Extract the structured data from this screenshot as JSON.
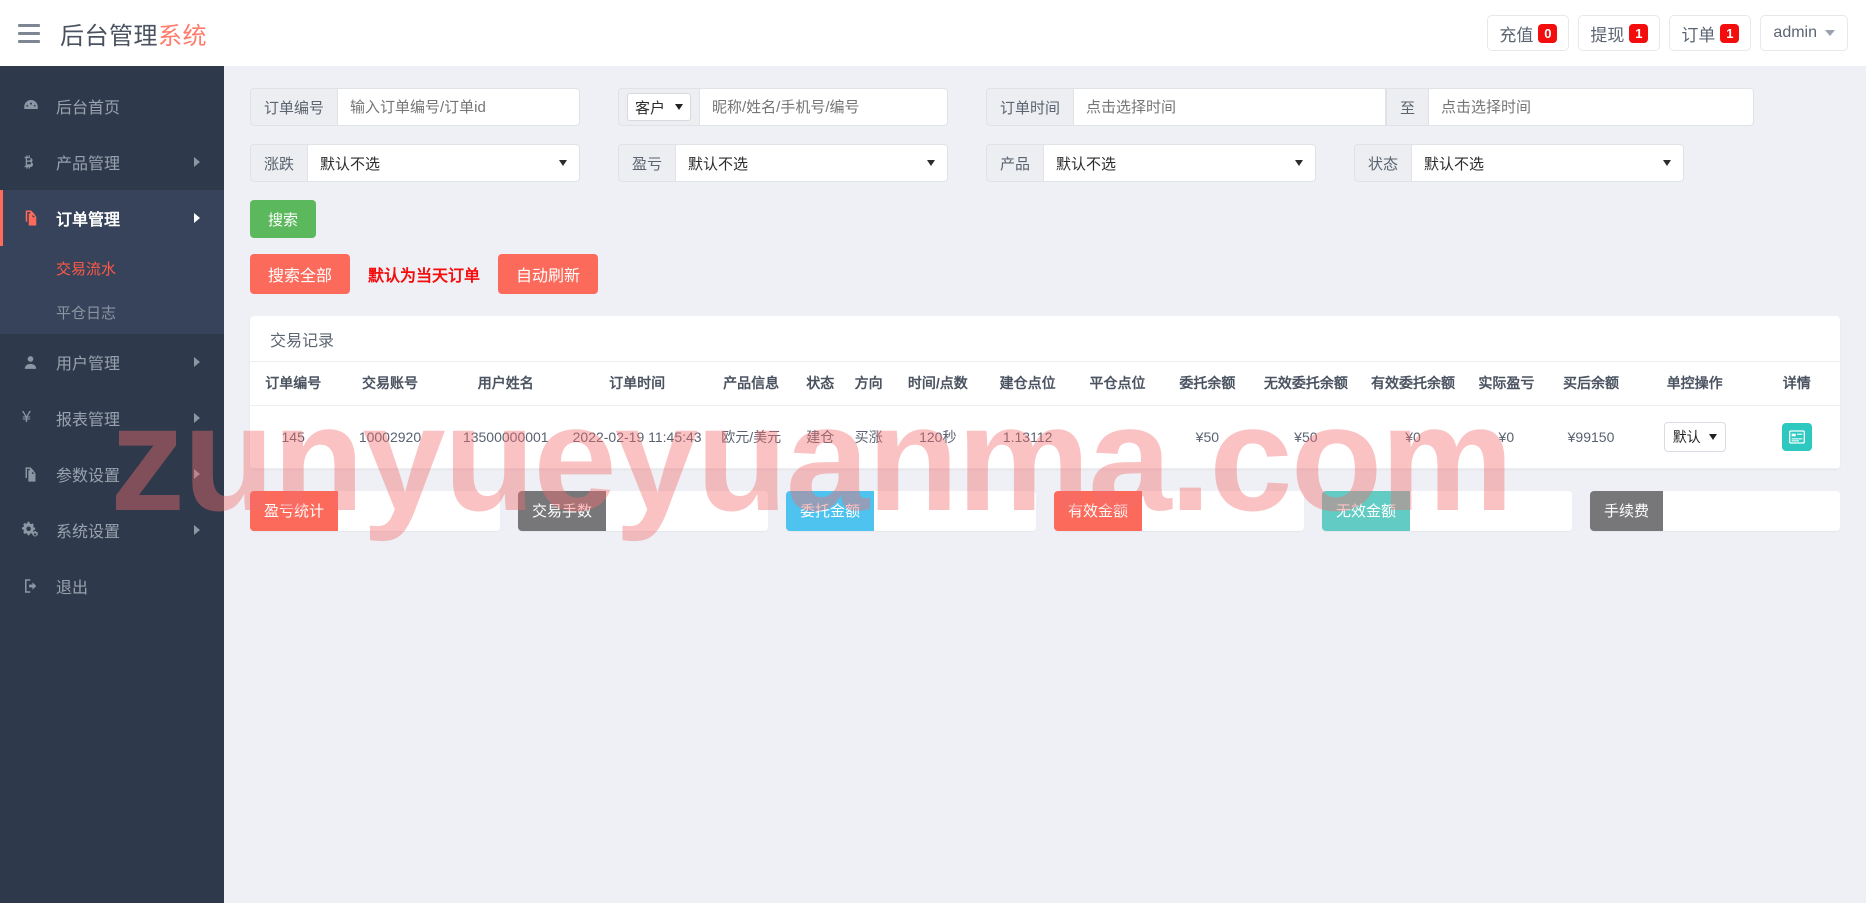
{
  "header": {
    "menu_icon": "hamburger-icon",
    "title_main": "后台管理",
    "title_accent": "系统",
    "actions": [
      {
        "label": "充值",
        "count": "0"
      },
      {
        "label": "提现",
        "count": "1"
      },
      {
        "label": "订单",
        "count": "1"
      }
    ],
    "user": "admin"
  },
  "sidebar": {
    "items": [
      {
        "label": "后台首页",
        "icon": "dashboard-icon",
        "has_arrow": false,
        "active": false
      },
      {
        "label": "产品管理",
        "icon": "bitcoin-icon",
        "has_arrow": true,
        "active": false
      },
      {
        "label": "订单管理",
        "icon": "orders-icon",
        "has_arrow": true,
        "active": true
      },
      {
        "label": "用户管理",
        "icon": "user-icon",
        "has_arrow": true,
        "active": false
      },
      {
        "label": "报表管理",
        "icon": "yen-icon",
        "has_arrow": true,
        "active": false
      },
      {
        "label": "参数设置",
        "icon": "copy-icon",
        "has_arrow": true,
        "active": false
      },
      {
        "label": "系统设置",
        "icon": "gears-icon",
        "has_arrow": true,
        "active": false
      },
      {
        "label": "退出",
        "icon": "logout-icon",
        "has_arrow": false,
        "active": false
      }
    ],
    "submenu": [
      {
        "label": "交易流水",
        "current": true
      },
      {
        "label": "平仓日志",
        "current": false
      }
    ]
  },
  "filters": {
    "order_no": {
      "label": "订单编号",
      "placeholder": "输入订单编号/订单id",
      "value": ""
    },
    "customer": {
      "label": "客户",
      "placeholder": "昵称/姓名/手机号/编号",
      "value": ""
    },
    "order_time": {
      "label": "订单时间",
      "placeholder": "点击选择时间",
      "to_label": "至",
      "placeholder2": "点击选择时间",
      "value": "",
      "value2": ""
    },
    "updown": {
      "label": "涨跌",
      "value": "默认不选"
    },
    "profit": {
      "label": "盈亏",
      "value": "默认不选"
    },
    "product": {
      "label": "产品",
      "value": "默认不选"
    },
    "status": {
      "label": "状态",
      "value": "默认不选"
    }
  },
  "buttons": {
    "search": "搜索",
    "search_all": "搜索全部",
    "hint": "默认为当天订单",
    "auto_refresh": "自动刷新"
  },
  "table": {
    "card_title": "交易记录",
    "columns": [
      "订单编号",
      "交易账号",
      "用户姓名",
      "订单时间",
      "产品信息",
      "状态",
      "方向",
      "时间/点数",
      "建仓点位",
      "平仓点位",
      "委托余额",
      "无效委托余额",
      "有效委托余额",
      "实际盈亏",
      "买后余额",
      "单控操作",
      "详情"
    ],
    "rows": [
      {
        "order_no": "145",
        "account": "10002920",
        "username": "13500000001",
        "order_time": "2022-02-19 11:45:43",
        "product": "欧元/美元",
        "status": "建仓",
        "direction": "买涨",
        "time_points": "120秒",
        "open_price": "1.13112",
        "close_price": "",
        "entrust_balance": "¥50",
        "invalid_entrust": "¥50",
        "valid_entrust": "¥0",
        "actual_profit": "¥0",
        "balance_after": "¥99150",
        "control": "默认",
        "detail_icon": "detail-card-icon"
      }
    ]
  },
  "summary": [
    {
      "label": "盈亏统计",
      "value": "",
      "color": "#fb6a5a"
    },
    {
      "label": "交易手数",
      "value": "",
      "color": "#77777a"
    },
    {
      "label": "委托金额",
      "value": "",
      "color": "#4ec3ef"
    },
    {
      "label": "有效金额",
      "value": "",
      "color": "#fb6a5a"
    },
    {
      "label": "无效金额",
      "value": "",
      "color": "#62ccc4"
    },
    {
      "label": "手续费",
      "value": "",
      "color": "#77777a"
    }
  ],
  "watermark": "zunyueyuanma.com"
}
